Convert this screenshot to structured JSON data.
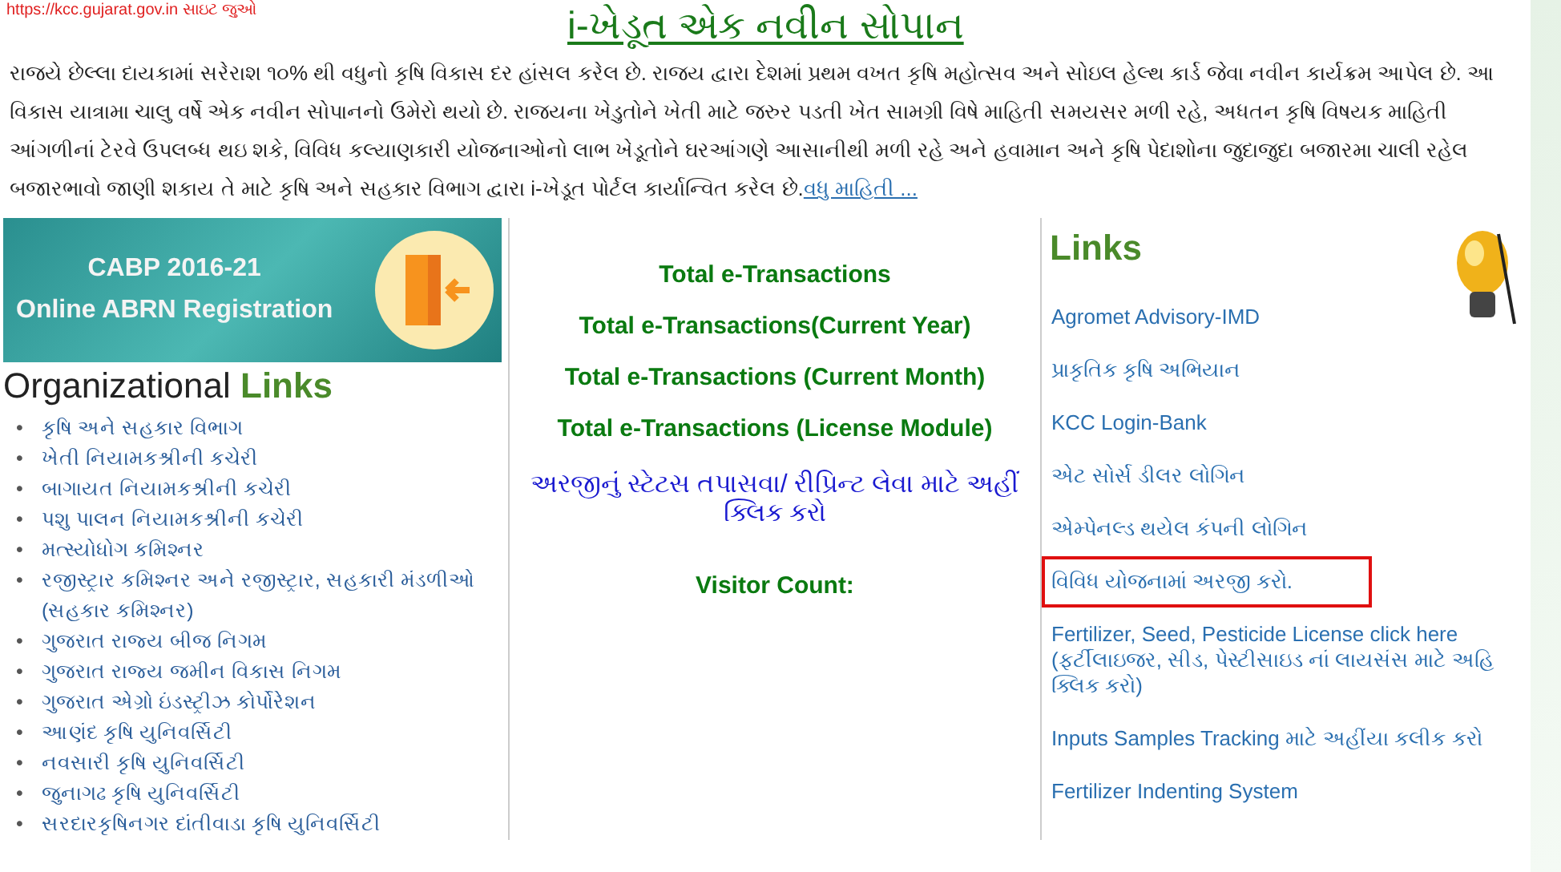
{
  "top_link": "https://kcc.gujarat.gov.in સાઇટ જુઓ",
  "intro": {
    "title": "i-ખેડૂત એક નવીન સોપાન",
    "text": "રાજયે છેલ્લા દાયકામાં સરેરાશ ૧૦% થી વધુનો કૃષિ વિકાસ દર હાંસલ કરેલ છે. રાજય દ્વારા દેશમાં પ્રથમ વખત કૃષિ મહોત્સવ અને સોઇલ હેલ્થ કાર્ડ જેવા નવીન કાર્યક્રમ આપેલ છે. આ વિકાસ યાત્રામા ચાલુ વર્ષે એક નવીન સોપાનનો ઉમેરો થયો છે. રાજયના ખેડુતોને ખેતી માટે જરુર પડતી ખેત સામગ્રી વિષે માહિતી સમયસર મળી રહે, અધતન કૃષિ વિષયક માહિતી આંગળીનાં ટેરવે ઉપલબ્ધ થઇ શકે, વિવિધ કલ્યાણકારી યોજનાઓનો લાભ ખેડૂતોને ઘરઆંગણે આસાનીથી મળી રહે અને હવામાન અને કૃષિ પેદાશોના જુદાજુદા બજારમા ચાલી રહેલ બજારભાવો જાણી શકાય તે માટે કૃષિ અને સહકાર વિભાગ દ્વારા i-ખેડૂત પોર્ટલ કાર્યાન્વિત કરેલ છે.",
    "more_link": "વધુ માહિતી ..."
  },
  "banner": {
    "line1": "CABP 2016-21",
    "line2": "Online ABRN Registration"
  },
  "org_links": {
    "heading": "Organizational",
    "heading_accent": "Links",
    "items": [
      {
        "marker": "•",
        "label": "કૃષિ અને સહકાર વિભાગ"
      },
      {
        "marker": "•",
        "label": "ખેતી નિયામકશ્રીની કચેરી"
      },
      {
        "marker": "•",
        "label": "બાગાયત નિયામકશ્રીની કચેરી"
      },
      {
        "marker": "•",
        "label": "પશુ પાલન નિયામકશ્રીની કચેરી"
      },
      {
        "marker": "•",
        "label": "મત્સ્યોધોગ કમિશ્નર"
      },
      {
        "marker": "•",
        "label": "રજીસ્ટ્રાર કમિશ્નર અને રજીસ્ટ્રાર, સહકારી મંડળીઓ (સહકાર કમિશ્નર)"
      },
      {
        "marker": "•",
        "label": "ગુજરાત રાજ્ય બીજ નિગમ"
      },
      {
        "marker": "•",
        "label": "ગુજરાત રાજ્ય જમીન વિકાસ નિગમ"
      },
      {
        "marker": "•",
        "label": "ગુજરાત એગ્રો ઇંડસ્ટ્રીઝ કોર્પોરેશન"
      },
      {
        "marker": "•",
        "label": "આણંદ કૃષિ યુનિવર્સિટી"
      },
      {
        "marker": "•",
        "label": "નવસારી કૃષિ યુનિવર્સિટી"
      },
      {
        "marker": "•",
        "label": "જુનાગઢ કૃષિ યુનિવર્સિટી"
      },
      {
        "marker": "•",
        "label": "સરદારકૃષિનગર દાંતીવાડા કૃષિ યુનિવર્સિટી"
      }
    ]
  },
  "stats": [
    "Total e-Transactions",
    "Total e-Transactions(Current Year)",
    "Total e-Transactions (Current Month)",
    "Total e-Transactions (License Module)"
  ],
  "status_link": "અરજીનું સ્ટેટસ તપાસવા/ રીપ્રિન્ટ લેવા માટે અહીં ક્લિક કરો",
  "visitor_count": "Visitor Count:",
  "links": {
    "heading": "Links",
    "items": [
      {
        "label": "Agromet Advisory-IMD",
        "highlighted": false
      },
      {
        "label": "પ્રાકૃતિક કૃષિ અભિયાન",
        "highlighted": false
      },
      {
        "label": "KCC Login-Bank",
        "highlighted": false
      },
      {
        "label": "એટ સોર્સ ડીલર લોગિન",
        "highlighted": false
      },
      {
        "label": "એમ્પેનલ્ડ થયેલ કંપની લોગિન",
        "highlighted": false
      },
      {
        "label": "વિવિધ યોજનામાં અરજી કરો.",
        "highlighted": true
      },
      {
        "label": "Fertilizer, Seed, Pesticide License click here (ફર્ટીલાઇજર, સીડ, પેસ્ટીસાઇડ નાં લાયસંસ માટે અહિ ક્લિક કરો)",
        "highlighted": false
      },
      {
        "label": "Inputs Samples Tracking માટે અહીંયા કલીક કરો",
        "highlighted": false
      },
      {
        "label": "Fertilizer Indenting System",
        "highlighted": false
      }
    ]
  }
}
